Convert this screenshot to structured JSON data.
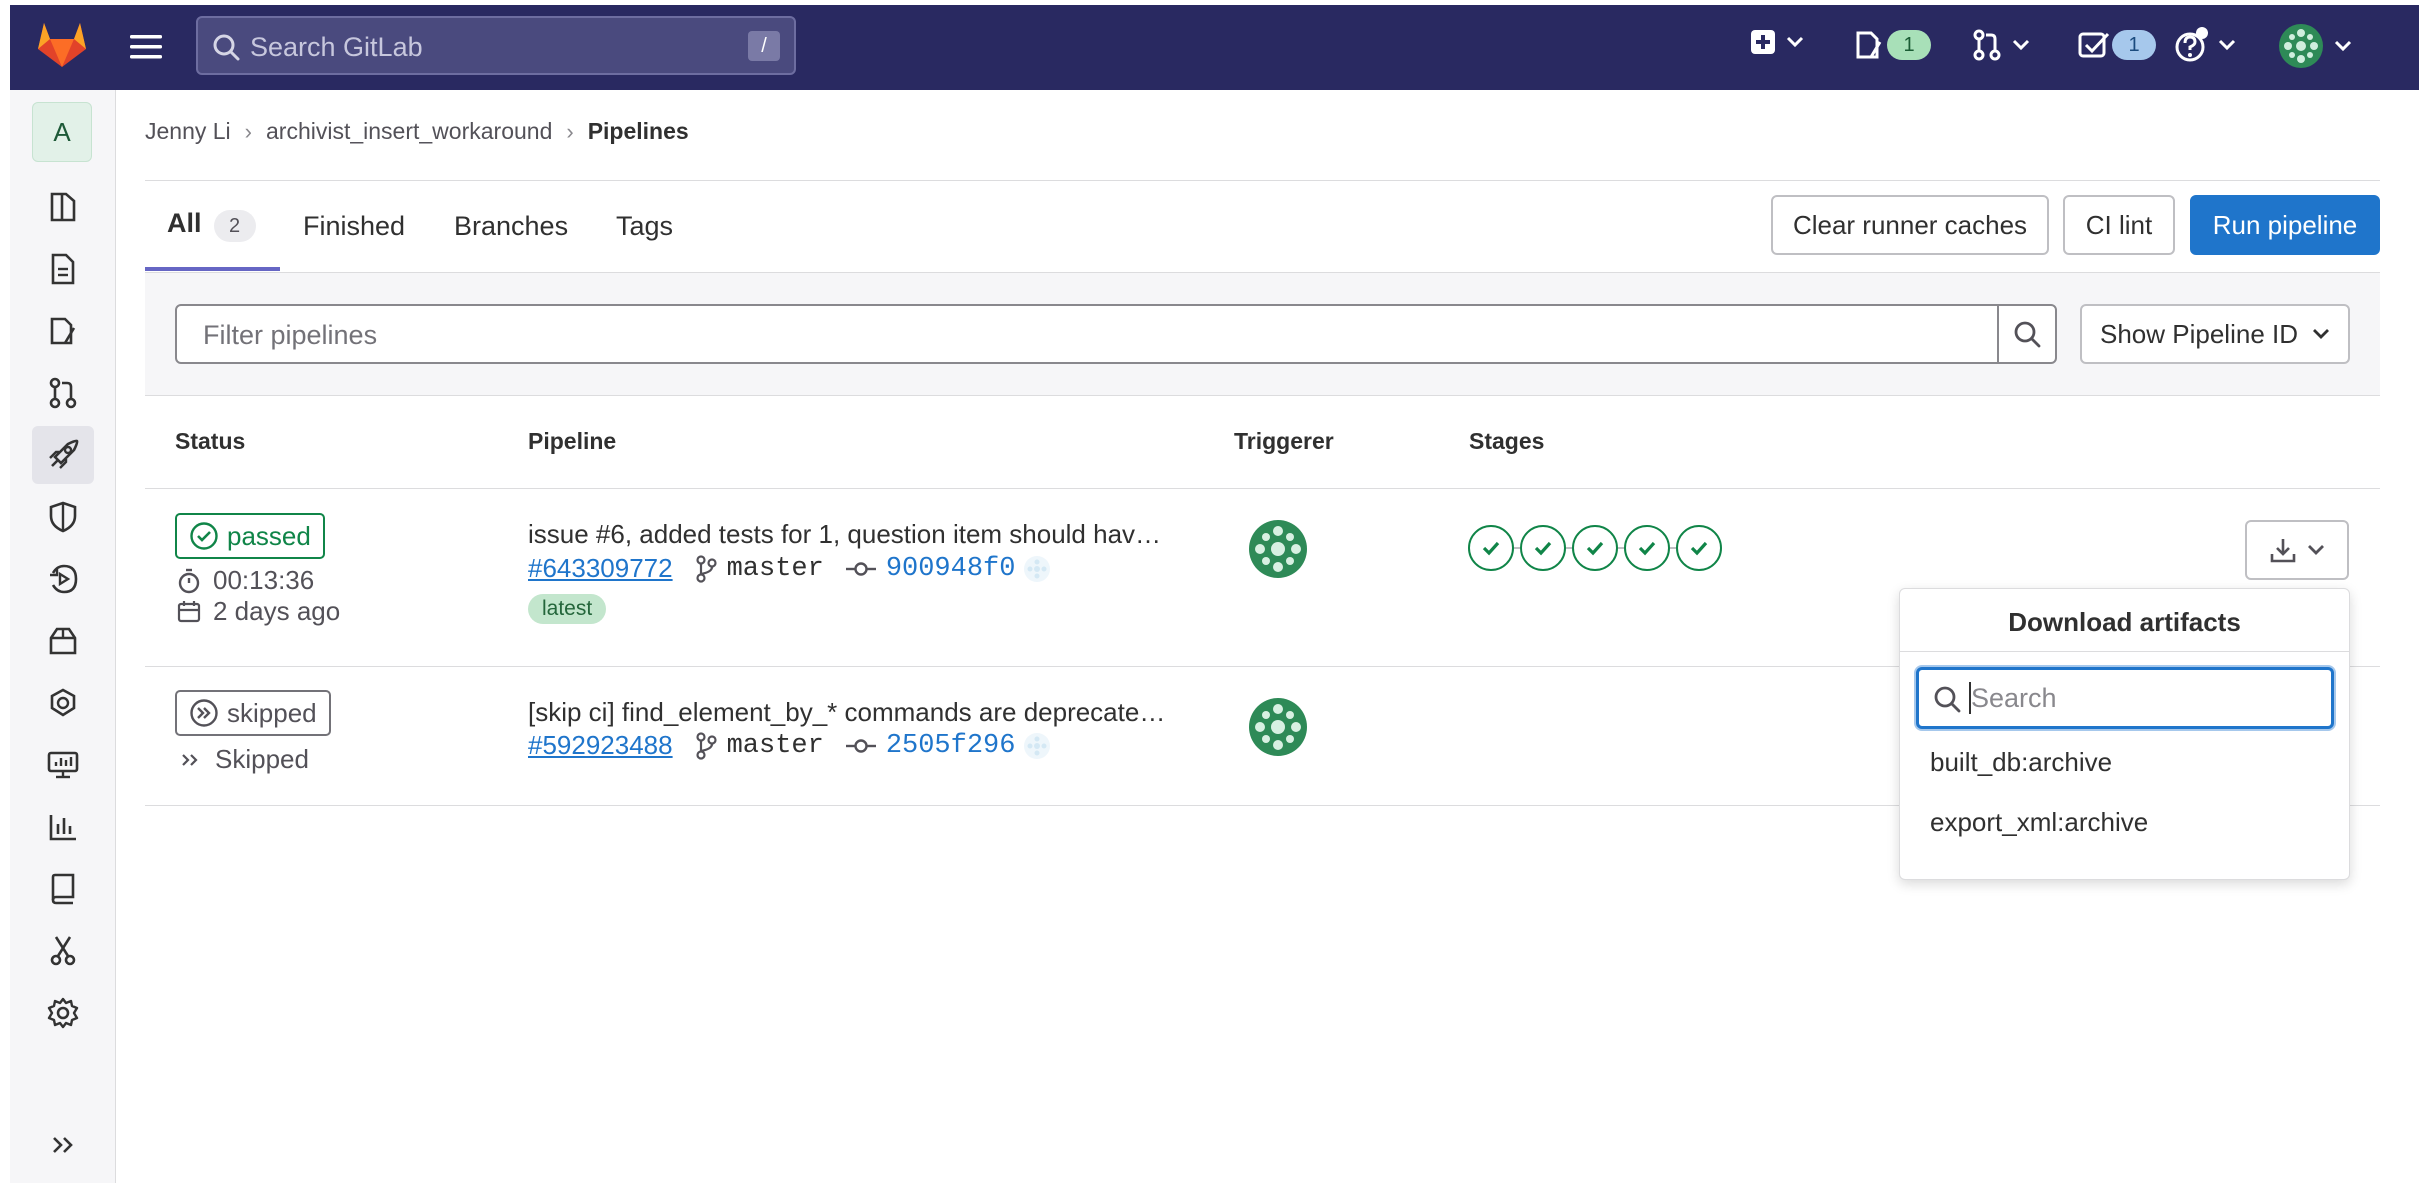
{
  "topbar": {
    "search_placeholder": "Search GitLab",
    "search_shortcut": "/",
    "issues_count": "1",
    "todos_count": "1",
    "colors": {
      "background": "#292961",
      "logo": "#e24329"
    }
  },
  "sidebar": {
    "project_initial": "A",
    "items": [
      {
        "icon": "project-overview-icon"
      },
      {
        "icon": "repository-icon"
      },
      {
        "icon": "issues-icon"
      },
      {
        "icon": "merge-requests-icon"
      },
      {
        "icon": "cicd-rocket-icon"
      },
      {
        "icon": "security-shield-icon"
      },
      {
        "icon": "deployments-icon"
      },
      {
        "icon": "packages-icon"
      },
      {
        "icon": "infrastructure-icon"
      },
      {
        "icon": "monitor-icon"
      },
      {
        "icon": "analytics-icon"
      },
      {
        "icon": "wiki-icon"
      },
      {
        "icon": "snippets-icon"
      },
      {
        "icon": "settings-icon"
      }
    ],
    "collapse_icon": "double-chevron-right-icon"
  },
  "breadcrumb": {
    "items": [
      "Jenny Li",
      "archivist_insert_workaround"
    ],
    "current": "Pipelines"
  },
  "tabs": [
    {
      "label": "All",
      "count": "2",
      "active": true
    },
    {
      "label": "Finished"
    },
    {
      "label": "Branches"
    },
    {
      "label": "Tags"
    }
  ],
  "actions": {
    "clear_caches": "Clear runner caches",
    "ci_lint": "CI lint",
    "run_pipeline": "Run pipeline"
  },
  "filter": {
    "placeholder": "Filter pipelines",
    "id_select": "Show Pipeline ID"
  },
  "table": {
    "headers": [
      "Status",
      "Pipeline",
      "Triggerer",
      "Stages"
    ],
    "rows": [
      {
        "status": "passed",
        "duration": "00:13:36",
        "finished": "2 days ago",
        "title": "issue #6, added tests for 1, question item should hav…",
        "id": "#643309772",
        "branch": "master",
        "sha": "900948f0",
        "badge": "latest",
        "stages": [
          "passed",
          "passed",
          "passed",
          "passed",
          "passed"
        ]
      },
      {
        "status": "skipped",
        "finished": "Skipped",
        "title": "[skip ci] find_element_by_* commands are deprecate…",
        "id": "#592923488",
        "branch": "master",
        "sha": "2505f296"
      }
    ]
  },
  "artifacts_dropdown": {
    "title": "Download artifacts",
    "search_placeholder": "Search",
    "items": [
      "built_db:archive",
      "export_xml:archive"
    ]
  }
}
